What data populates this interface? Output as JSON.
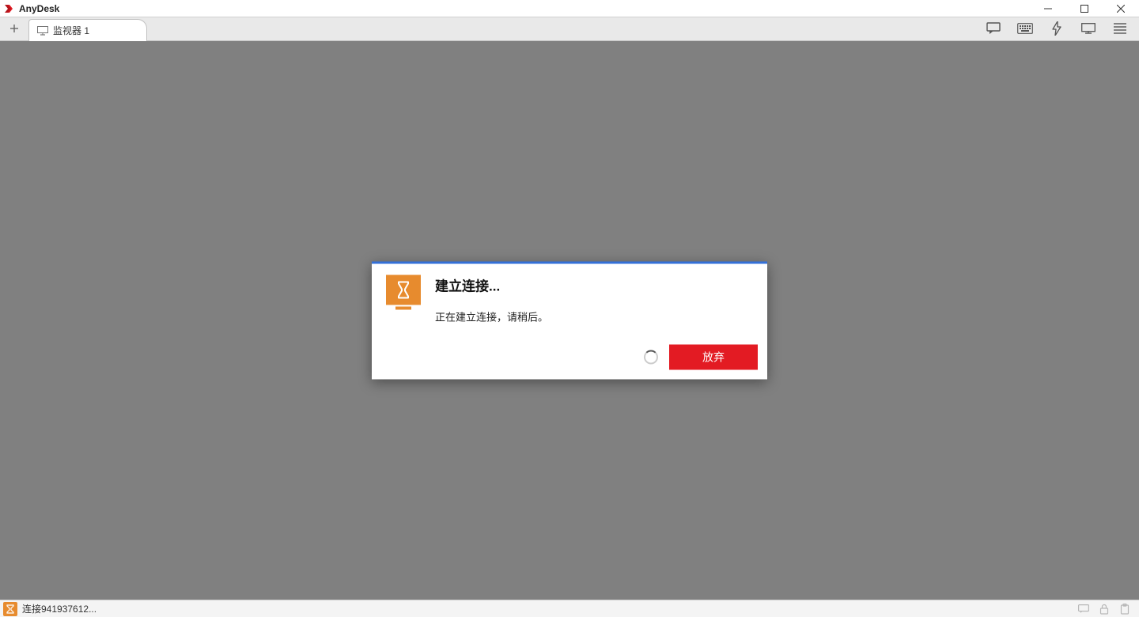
{
  "app": {
    "title": "AnyDesk"
  },
  "tabs": {
    "active": {
      "label": "监视器 1"
    }
  },
  "dialog": {
    "title": "建立连接...",
    "message": "正在建立连接，请稍后。",
    "abort_label": "放弃"
  },
  "status": {
    "text": "连接941937612..."
  }
}
